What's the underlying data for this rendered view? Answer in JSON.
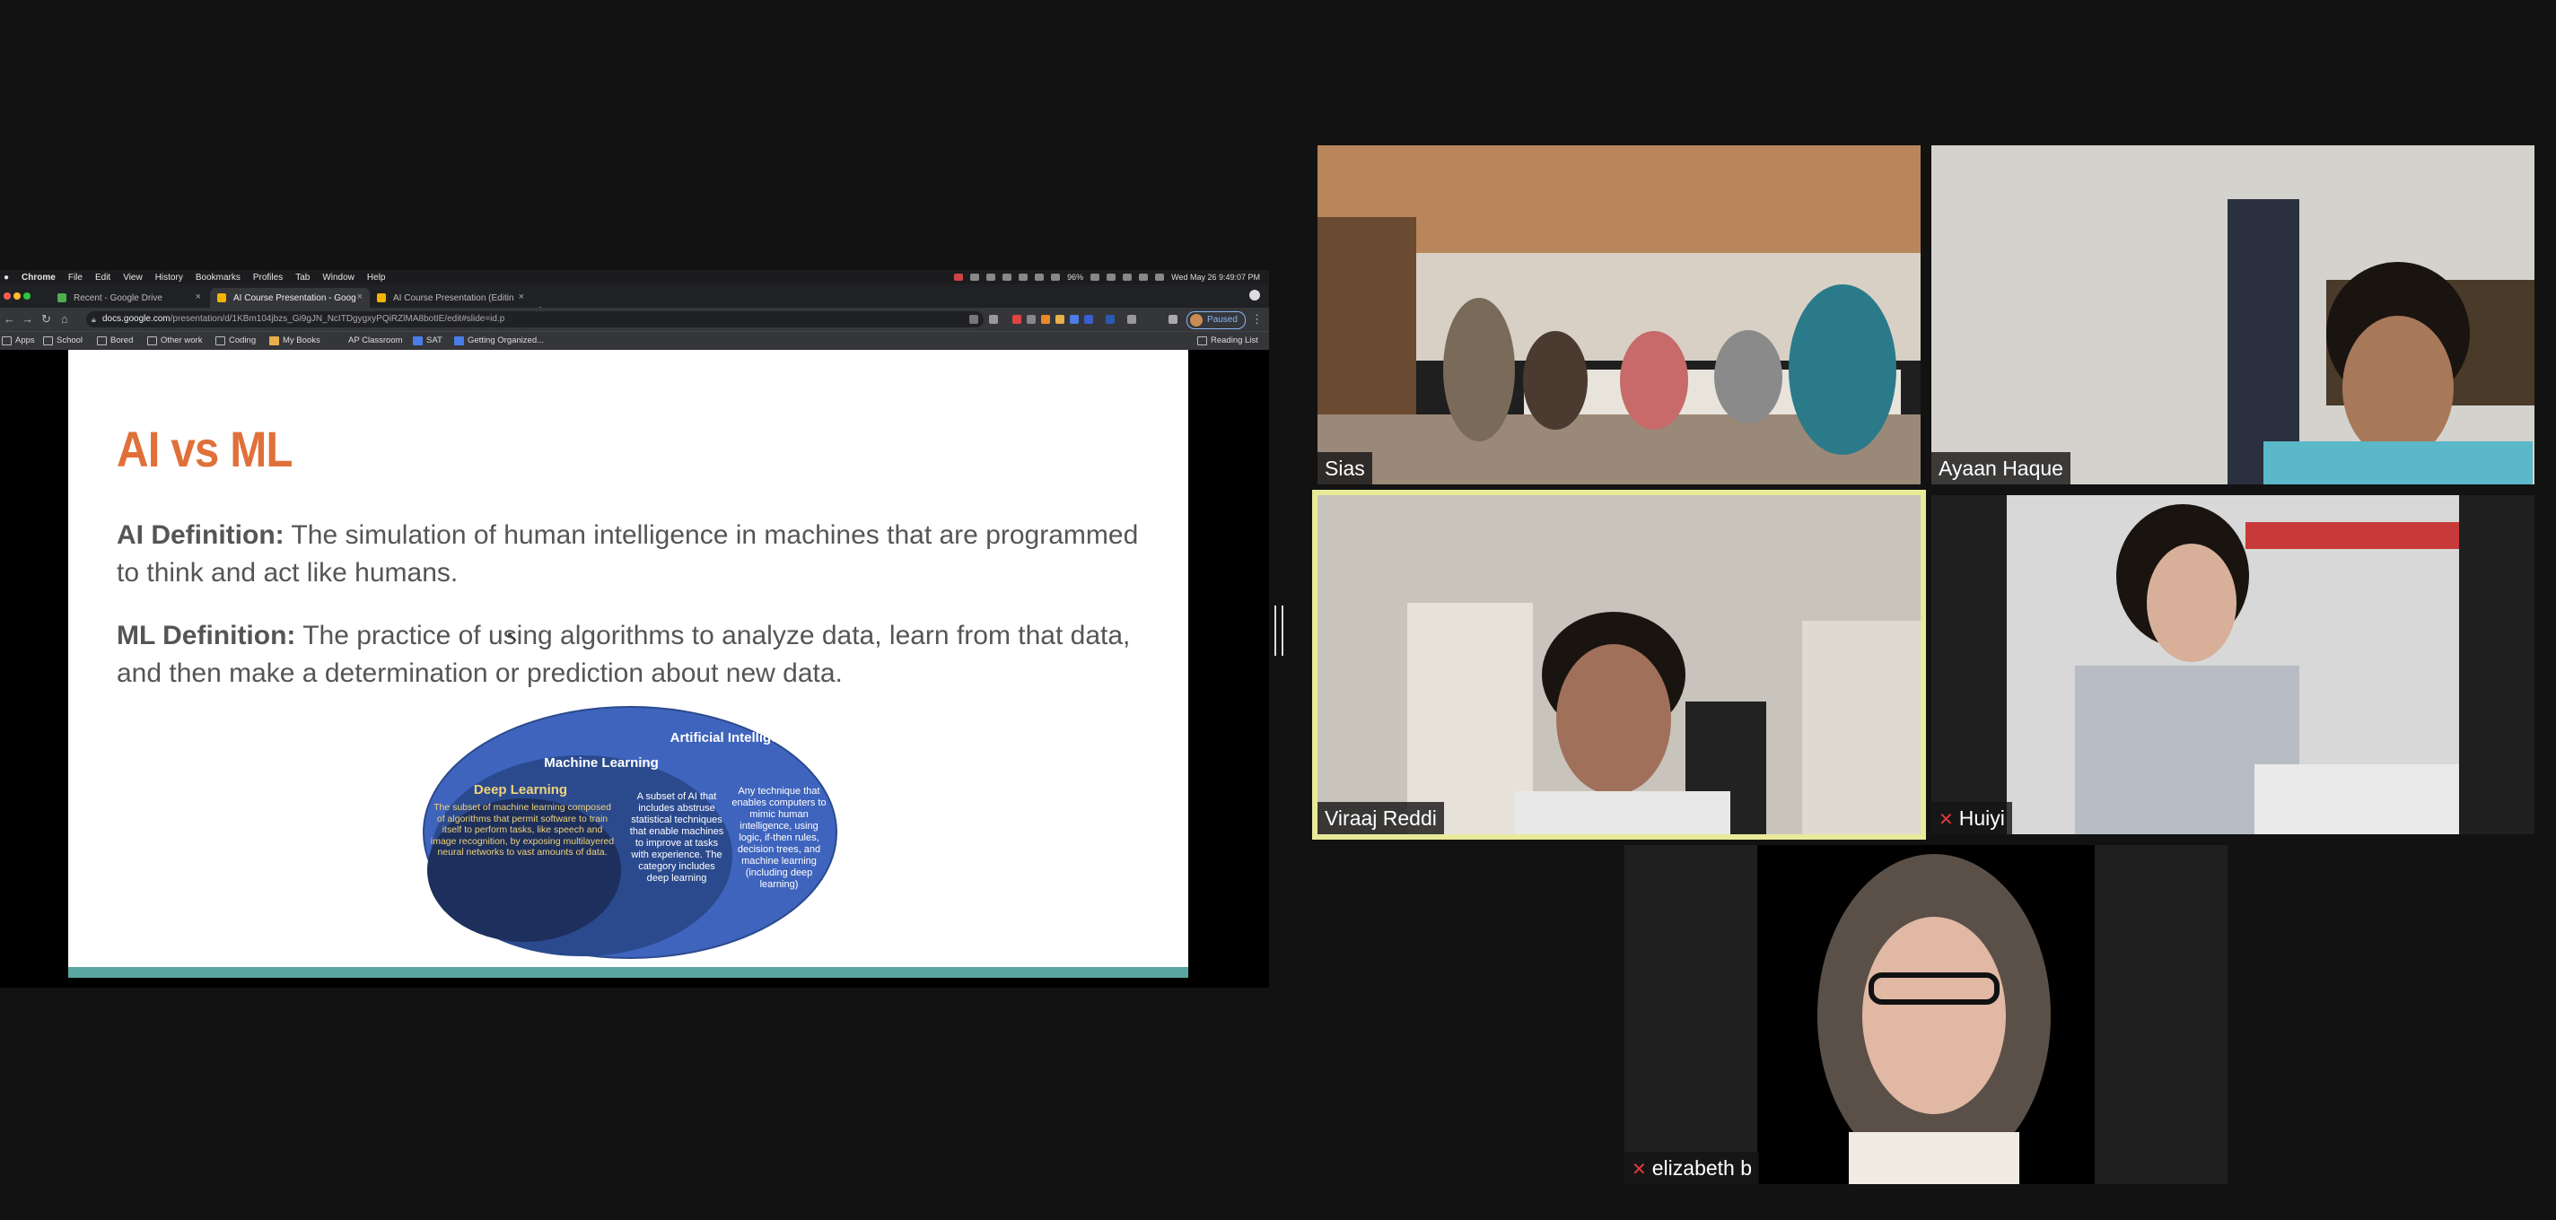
{
  "mac_menu": {
    "items": [
      "Chrome",
      "File",
      "Edit",
      "View",
      "History",
      "Bookmarks",
      "Profiles",
      "Tab",
      "Window",
      "Help"
    ],
    "battery": "96%",
    "clock": "Wed May 26  9:49:07 PM"
  },
  "browser": {
    "tabs": [
      {
        "label": "Recent - Google Drive",
        "active": false
      },
      {
        "label": "AI Course Presentation - Goog",
        "active": true
      },
      {
        "label": "AI Course Presentation (Editin",
        "active": false
      }
    ],
    "url_host": "docs.google.com",
    "url_path": "/presentation/d/1KBm104jbzs_Gi9gJN_NcITDgygxyPQiRZlMA8botIE/edit#slide=id.p",
    "profile_status": "Paused",
    "bookmarks": [
      "Apps",
      "School",
      "Bored",
      "Other work",
      "Coding",
      "My Books",
      "AP Classroom",
      "SAT",
      "Getting Organized..."
    ],
    "reading_list": "Reading List"
  },
  "slide": {
    "title": "AI vs ML",
    "ai_def_label": "AI Definition:",
    "ai_def_text": " The simulation of human intelligence in machines that are programmed to think and act like humans.",
    "ml_def_label": "ML Definition:",
    "ml_def_text": " The practice of using algorithms to analyze data, learn from that data, and then make a determination or prediction about new data.",
    "venn": {
      "ai_label": "Artificial Intelligence",
      "ai_text": "Any technique that enables computers to mimic human intelligence, using logic, if-then rules, decision trees, and machine learning (including deep learning)",
      "ml_label": "Machine Learning",
      "ml_text": "A subset of AI that includes abstruse statistical techniques that enable machines to improve at tasks with experience. The category includes deep learning",
      "dl_label": "Deep Learning",
      "dl_text": "The subset of machine learning composed of algorithms that permit software to train itself to perform tasks, like speech and image recognition, by exposing multilayered neural networks to vast amounts of data."
    },
    "colors": {
      "title": "#e0703a",
      "ai": "#3f64bd",
      "ml": "#2b4a8e",
      "dl": "#1d2f5c",
      "stripe": "#5aa6a0"
    }
  },
  "participants": [
    {
      "name": "Sias",
      "muted": false,
      "speaking": false
    },
    {
      "name": "Ayaan Haque",
      "muted": false,
      "speaking": false
    },
    {
      "name": "Viraaj Reddi",
      "muted": false,
      "speaking": true
    },
    {
      "name": "Huiyi",
      "muted": true,
      "speaking": false
    },
    {
      "name": "elizabeth b",
      "muted": true,
      "speaking": false
    }
  ]
}
